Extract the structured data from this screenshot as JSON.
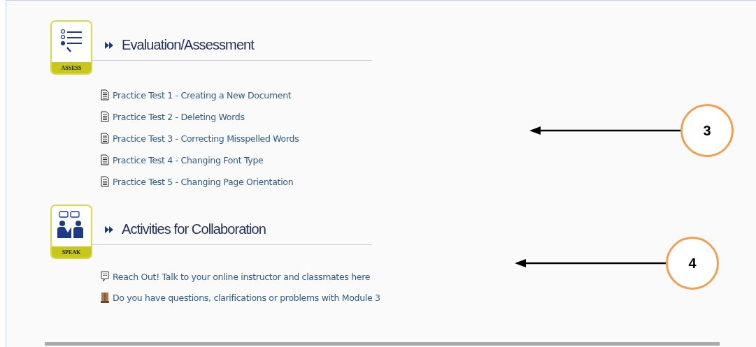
{
  "sections": [
    {
      "badge": {
        "kind": "assess",
        "label": "ASSESS"
      },
      "heading": "Evaluation/Assessment",
      "links": [
        {
          "kind": "document",
          "text": "Practice Test 1 - Creating a New Document"
        },
        {
          "kind": "document",
          "text": "Practice Test 2 - Deleting Words"
        },
        {
          "kind": "document",
          "text": "Practice Test 3 - Correcting Misspelled Words"
        },
        {
          "kind": "document",
          "text": "Practice Test 4 - Changing Font Type"
        },
        {
          "kind": "document",
          "text": "Practice Test 5 - Changing Page Orientation"
        }
      ],
      "callout": "3"
    },
    {
      "badge": {
        "kind": "speak",
        "label": "SPEAK"
      },
      "heading": "Activities for Collaboration",
      "links": [
        {
          "kind": "chat",
          "text": "Reach Out! Talk to your online instructor and classmates here"
        },
        {
          "kind": "forum",
          "text": "Do you have questions, clarifications or problems with Module 3"
        }
      ],
      "callout": "4"
    }
  ]
}
